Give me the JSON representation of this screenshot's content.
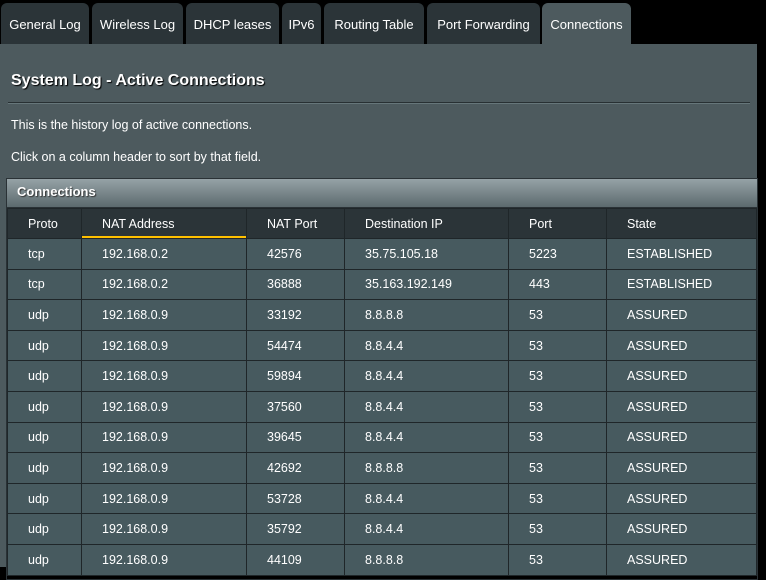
{
  "tabs": [
    "General Log",
    "Wireless Log",
    "DHCP leases",
    "IPv6",
    "Routing Table",
    "Port Forwarding",
    "Connections"
  ],
  "active_tab": "Connections",
  "title": "System Log - Active Connections",
  "desc1": "This is the history log of active connections.",
  "desc2": "Click on a column header to sort by that field.",
  "section": "Connections",
  "columns": [
    "Proto",
    "NAT Address",
    "NAT Port",
    "Destination IP",
    "Port",
    "State"
  ],
  "sorted_column": "NAT Address",
  "accent": "#ffc000",
  "rows": [
    [
      "tcp",
      "192.168.0.2",
      "42576",
      "35.75.105.18",
      "5223",
      "ESTABLISHED"
    ],
    [
      "tcp",
      "192.168.0.2",
      "36888",
      "35.163.192.149",
      "443",
      "ESTABLISHED"
    ],
    [
      "udp",
      "192.168.0.9",
      "33192",
      "8.8.8.8",
      "53",
      "ASSURED"
    ],
    [
      "udp",
      "192.168.0.9",
      "54474",
      "8.8.4.4",
      "53",
      "ASSURED"
    ],
    [
      "udp",
      "192.168.0.9",
      "59894",
      "8.8.4.4",
      "53",
      "ASSURED"
    ],
    [
      "udp",
      "192.168.0.9",
      "37560",
      "8.8.4.4",
      "53",
      "ASSURED"
    ],
    [
      "udp",
      "192.168.0.9",
      "39645",
      "8.8.4.4",
      "53",
      "ASSURED"
    ],
    [
      "udp",
      "192.168.0.9",
      "42692",
      "8.8.8.8",
      "53",
      "ASSURED"
    ],
    [
      "udp",
      "192.168.0.9",
      "53728",
      "8.8.4.4",
      "53",
      "ASSURED"
    ],
    [
      "udp",
      "192.168.0.9",
      "35792",
      "8.8.4.4",
      "53",
      "ASSURED"
    ],
    [
      "udp",
      "192.168.0.9",
      "44109",
      "8.8.8.8",
      "53",
      "ASSURED"
    ]
  ]
}
